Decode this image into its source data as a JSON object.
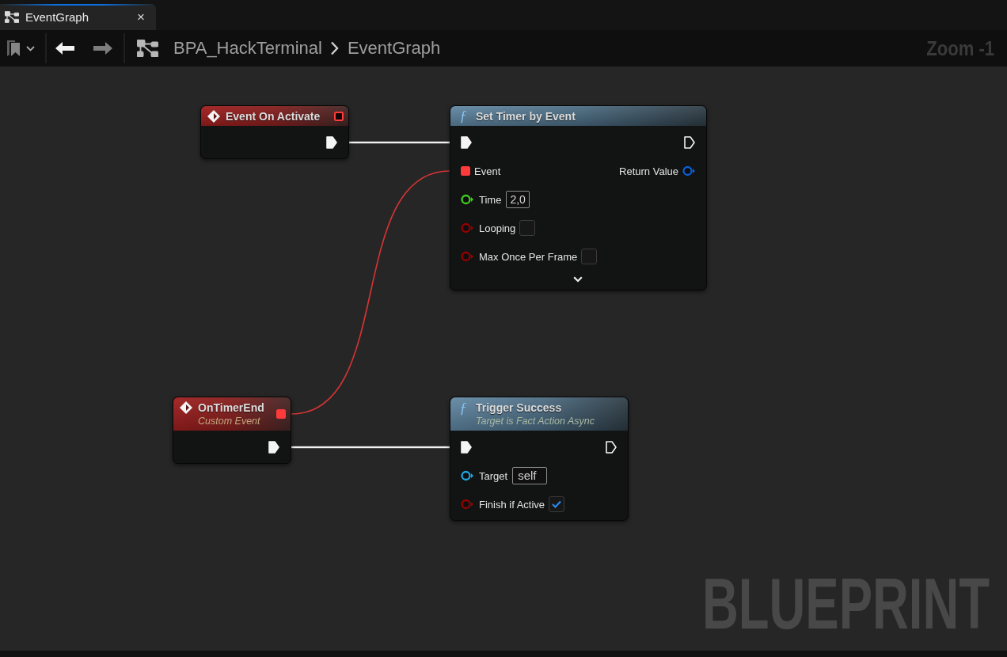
{
  "tabs": [
    {
      "title": "EventGraph",
      "close": "×",
      "selected": true
    }
  ],
  "toolbar": {
    "back": {
      "disabled": false
    },
    "forward": {
      "disabled": true
    },
    "breadcrumbs": [
      "BPA_HackTerminal",
      "EventGraph"
    ],
    "zoom_label": "Zoom -1"
  },
  "graph": {
    "nodes": [
      {
        "kind": "event",
        "title": "Event On Activate",
        "delegate_out": {
          "connected": false
        },
        "exec_out": {
          "connected": true
        }
      },
      {
        "kind": "function",
        "icon": "ƒ",
        "title": "Set Timer by Event",
        "exec_in": {
          "connected": true
        },
        "exec_out": {
          "connected": false
        },
        "inputs": [
          {
            "kind": "delegate",
            "label": "Event",
            "connected": true
          },
          {
            "kind": "float",
            "label": "Time",
            "value": "2,0",
            "connected": false
          },
          {
            "kind": "bool",
            "label": "Looping",
            "checked": false,
            "connected": false
          },
          {
            "kind": "bool",
            "label": "Max Once Per Frame",
            "checked": false,
            "connected": false
          }
        ],
        "outputs": [
          {
            "kind": "struct",
            "label": "Return Value",
            "connected": false
          }
        ],
        "advanced_expanded": false
      },
      {
        "kind": "event",
        "title": "OnTimerEnd",
        "subtitle": "Custom Event",
        "delegate_out": {
          "connected": true
        },
        "exec_out": {
          "connected": true
        }
      },
      {
        "kind": "function",
        "icon": "ƒ",
        "title": "Trigger Success",
        "subtitle": "Target is Fact Action Async",
        "exec_in": {
          "connected": true
        },
        "exec_out": {
          "connected": false
        },
        "inputs": [
          {
            "kind": "object",
            "label": "Target",
            "value": "self",
            "connected": false
          },
          {
            "kind": "bool",
            "label": "Finish if Active",
            "checked": true,
            "connected": false
          }
        ]
      }
    ],
    "watermark": "BLUEPRINT"
  }
}
